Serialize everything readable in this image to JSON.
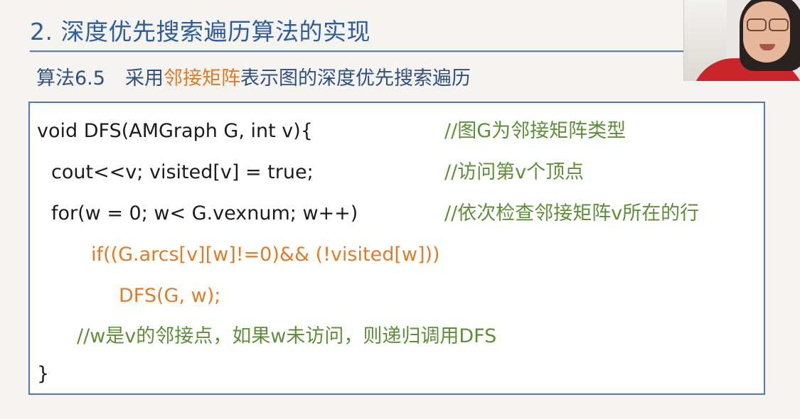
{
  "slide": {
    "title": "2. 深度优先搜索遍历算法的实现",
    "subtitle": {
      "label": "算法6.5",
      "prefix": "采用",
      "highlight": "邻接矩阵",
      "suffix": "表示图的深度优先搜索遍历"
    }
  },
  "code": {
    "lines": [
      {
        "code": "void DFS(AMGraph G, int v){",
        "comment": "//图G为邻接矩阵类型"
      },
      {
        "code": "cout<<v;  visited[v] = true;",
        "comment": "//访问第v个顶点"
      },
      {
        "code": "for(w = 0; w< G.vexnum; w++)",
        "comment": "//依次检查邻接矩阵v所在的行"
      },
      {
        "code": "if((G.arcs[v][w]!=0)&& (!visited[w]))",
        "comment": ""
      },
      {
        "code": "DFS(G, w);",
        "comment": ""
      },
      {
        "code": "",
        "comment": "//w是v的邻接点，如果w未访问，则递归调用DFS"
      },
      {
        "code": "}",
        "comment": ""
      }
    ]
  },
  "colors": {
    "title": "#2f5d9b",
    "highlight": "#e07b27",
    "comment": "#5f8e3a",
    "box_border": "#4f78b3"
  },
  "icons": {
    "webcam": "presenter-video-feed"
  }
}
